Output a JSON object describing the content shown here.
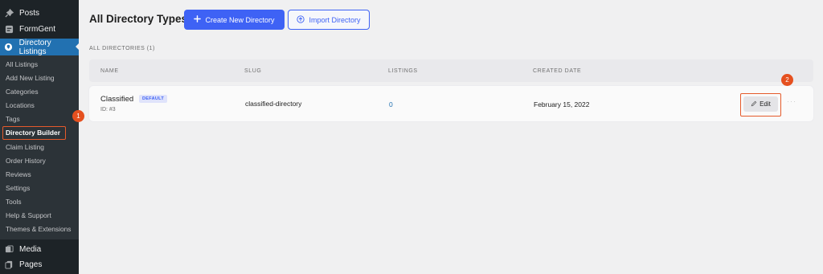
{
  "sidebar": {
    "top_items": [
      {
        "label": "Posts",
        "icon": "pin-icon"
      },
      {
        "label": "FormGent",
        "icon": "form-icon"
      },
      {
        "label": "Directory Listings",
        "icon": "directory-icon"
      }
    ],
    "submenu": [
      "All Listings",
      "Add New Listing",
      "Categories",
      "Locations",
      "Tags",
      "Directory Builder",
      "Claim Listing",
      "Order History",
      "Reviews",
      "Settings",
      "Tools",
      "Help & Support",
      "Themes & Extensions"
    ],
    "bottom_items": [
      {
        "label": "Media",
        "icon": "media-icon"
      },
      {
        "label": "Pages",
        "icon": "pages-icon"
      }
    ],
    "current_submenu": "Directory Builder"
  },
  "header": {
    "title": "All Directory Types",
    "create_button": "Create New Directory",
    "import_button": "Import Directory"
  },
  "section_label": "ALL DIRECTORIES (1)",
  "table": {
    "columns": [
      "NAME",
      "SLUG",
      "LISTINGS",
      "CREATED DATE"
    ],
    "rows": [
      {
        "name": "Classified",
        "badge": "DEFAULT",
        "id": "ID: #3",
        "slug": "classified-directory",
        "listings": "0",
        "created": "February 15, 2022",
        "action": "Edit",
        "more": "···"
      }
    ]
  },
  "annotations": {
    "step1": "1",
    "step2": "2"
  },
  "colors": {
    "accent": "#3e62f5",
    "highlight": "#e55a2b",
    "sidebar": "#1d2327",
    "active": "#2271b1"
  }
}
